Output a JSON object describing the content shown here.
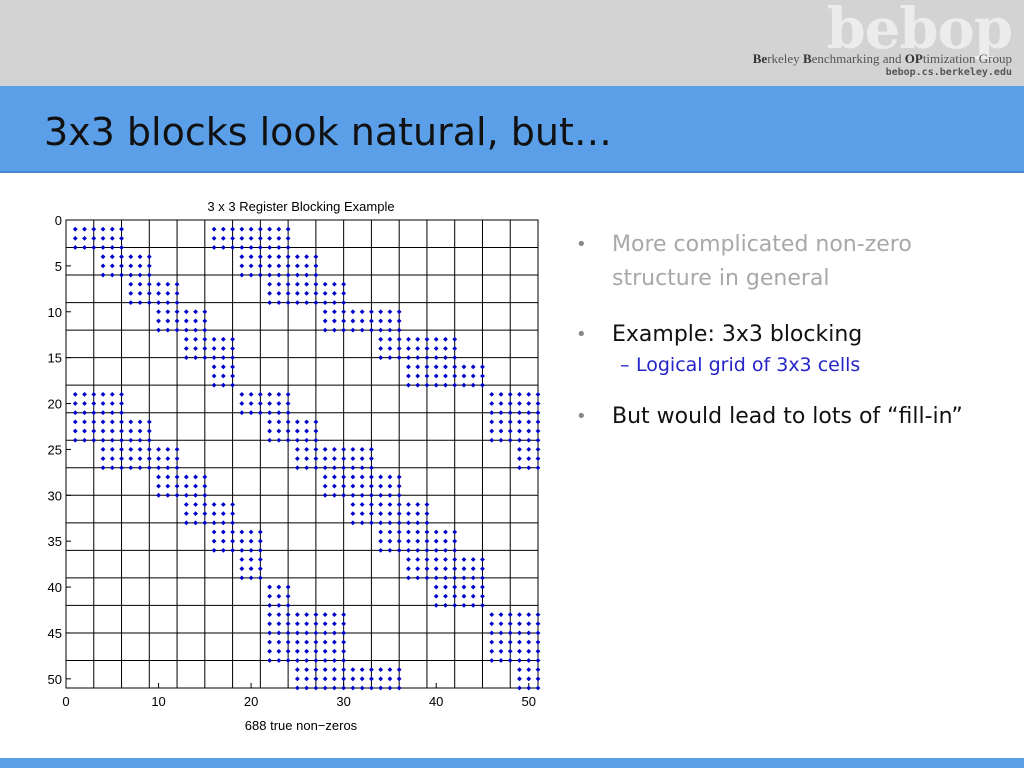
{
  "header": {
    "logo": "bebop",
    "group_name_parts": [
      "Be",
      "rkeley ",
      "B",
      "enchmarking and ",
      "OP",
      "timization Group"
    ],
    "url": "bebop.cs.berkeley.edu"
  },
  "slide": {
    "title": "3x3 blocks look natural, but…"
  },
  "bullets": [
    {
      "text": "More complicated non-zero structure in general",
      "style": "muted"
    },
    {
      "text": "Example: 3x3 blocking",
      "style": "dark",
      "sub": [
        "Logical grid of 3x3 cells"
      ]
    },
    {
      "text": "But would lead to lots of “fill-in”",
      "style": "dark"
    }
  ],
  "chart_data": {
    "type": "scatter",
    "title": "3 x 3 Register Blocking Example",
    "xlabel": "688 true non−zeros",
    "ylabel": "",
    "xlim": [
      0,
      51
    ],
    "ylim": [
      0,
      51
    ],
    "y_inverted": true,
    "xticks": [
      0,
      10,
      20,
      30,
      40,
      50
    ],
    "yticks": [
      0,
      5,
      10,
      15,
      20,
      25,
      30,
      35,
      40,
      45,
      50
    ],
    "grid": "3x3 block cells (lines every 3 units)",
    "marker": "diamond",
    "color": "#0000cc",
    "block_size": 3,
    "note": "Nonzero 3x3 blocks listed as [block_row, block_col]; each block covers rows 3r..3r+2 and cols 3c..3c+2",
    "blocks": [
      [
        0,
        0
      ],
      [
        0,
        1
      ],
      [
        0,
        5
      ],
      [
        0,
        6
      ],
      [
        0,
        7
      ],
      [
        1,
        1
      ],
      [
        1,
        2
      ],
      [
        1,
        6
      ],
      [
        1,
        7
      ],
      [
        1,
        8
      ],
      [
        2,
        2
      ],
      [
        2,
        3
      ],
      [
        2,
        7
      ],
      [
        2,
        8
      ],
      [
        2,
        9
      ],
      [
        3,
        3
      ],
      [
        3,
        4
      ],
      [
        3,
        9
      ],
      [
        3,
        10
      ],
      [
        3,
        11
      ],
      [
        4,
        4
      ],
      [
        4,
        5
      ],
      [
        4,
        11
      ],
      [
        4,
        12
      ],
      [
        4,
        13
      ],
      [
        5,
        5
      ],
      [
        5,
        12
      ],
      [
        5,
        13
      ],
      [
        5,
        14
      ],
      [
        6,
        0
      ],
      [
        6,
        1
      ],
      [
        6,
        6
      ],
      [
        6,
        7
      ],
      [
        6,
        15
      ],
      [
        6,
        16
      ],
      [
        7,
        0
      ],
      [
        7,
        1
      ],
      [
        7,
        2
      ],
      [
        7,
        7
      ],
      [
        7,
        8
      ],
      [
        7,
        15
      ],
      [
        7,
        16
      ],
      [
        7,
        17
      ],
      [
        8,
        1
      ],
      [
        8,
        2
      ],
      [
        8,
        3
      ],
      [
        8,
        8
      ],
      [
        8,
        9
      ],
      [
        8,
        10
      ],
      [
        8,
        16
      ],
      [
        8,
        17
      ],
      [
        9,
        3
      ],
      [
        9,
        4
      ],
      [
        9,
        9
      ],
      [
        9,
        10
      ],
      [
        9,
        11
      ],
      [
        10,
        4
      ],
      [
        10,
        5
      ],
      [
        10,
        10
      ],
      [
        10,
        11
      ],
      [
        10,
        12
      ],
      [
        11,
        5
      ],
      [
        11,
        6
      ],
      [
        11,
        11
      ],
      [
        11,
        12
      ],
      [
        11,
        13
      ],
      [
        12,
        6
      ],
      [
        12,
        12
      ],
      [
        12,
        13
      ],
      [
        12,
        14
      ],
      [
        13,
        7
      ],
      [
        13,
        13
      ],
      [
        13,
        14
      ],
      [
        14,
        7
      ],
      [
        14,
        8
      ],
      [
        14,
        9
      ],
      [
        14,
        15
      ],
      [
        14,
        16
      ],
      [
        15,
        7
      ],
      [
        15,
        8
      ],
      [
        15,
        9
      ],
      [
        15,
        15
      ],
      [
        15,
        16
      ],
      [
        15,
        17
      ],
      [
        16,
        8
      ],
      [
        16,
        9
      ],
      [
        16,
        10
      ],
      [
        16,
        11
      ],
      [
        16,
        16
      ],
      [
        16,
        17
      ]
    ]
  }
}
